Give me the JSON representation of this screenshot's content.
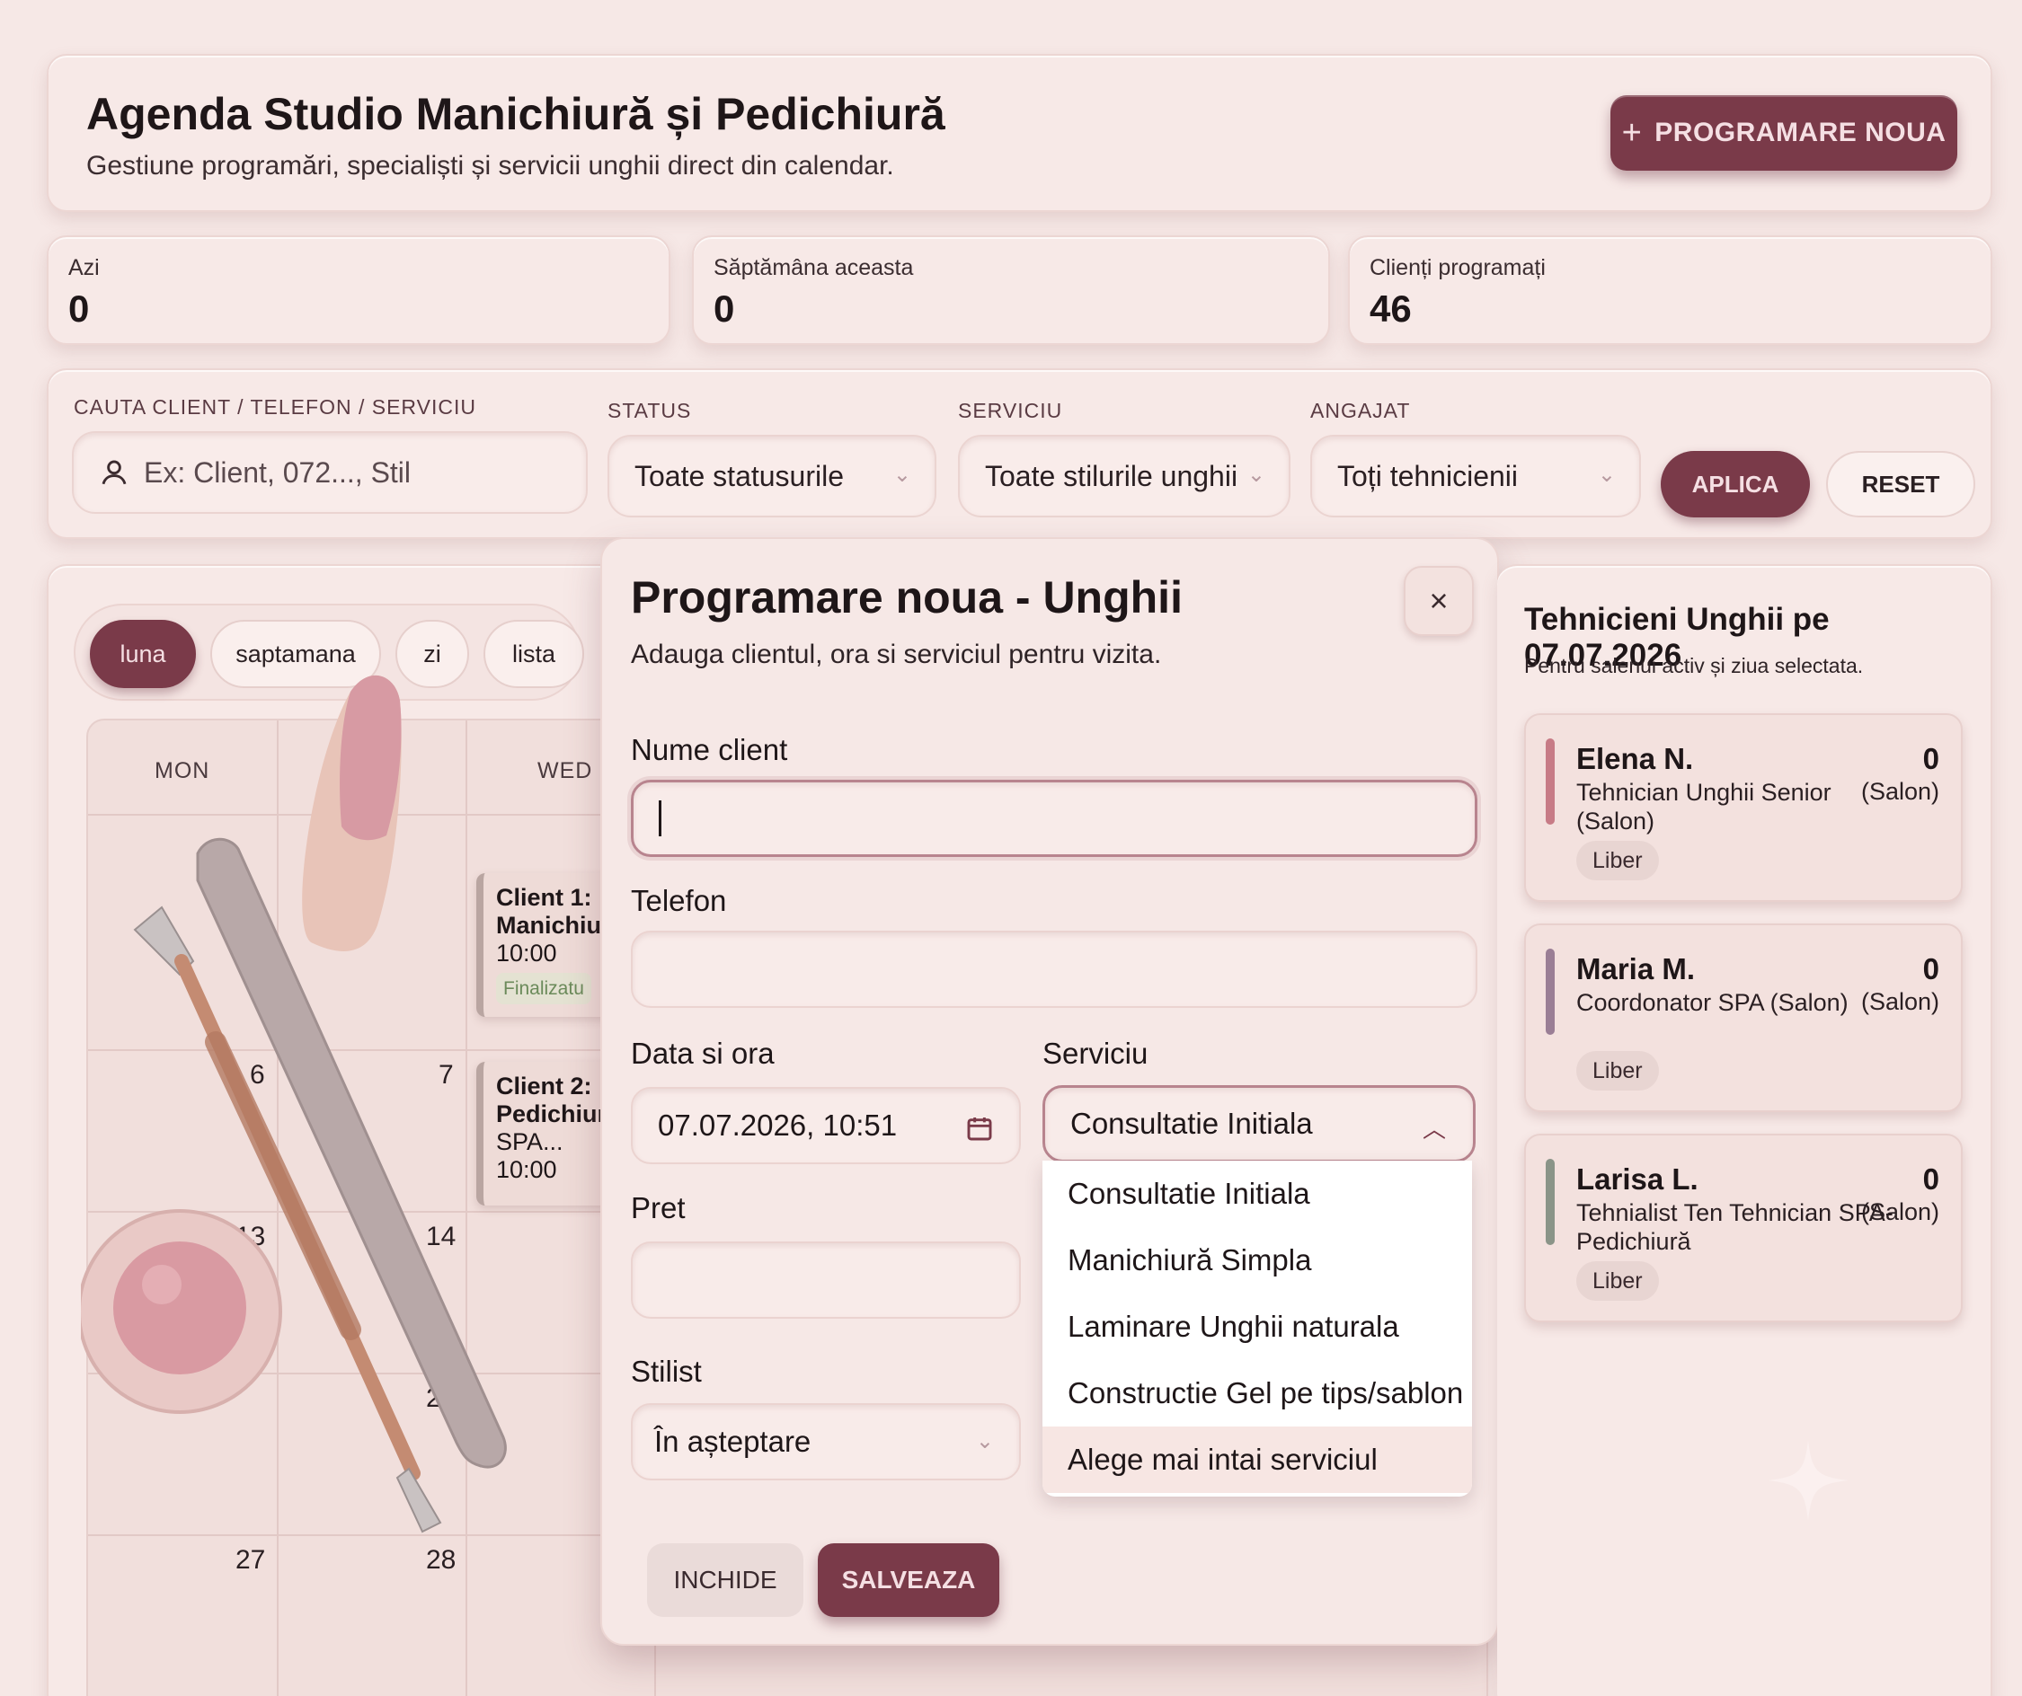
{
  "header": {
    "title": "Agenda Studio Manichiură și Pedichiură",
    "subtitle": "Gestiune programări, specialiști și servicii unghii direct din calendar.",
    "new_button": "PROGRAMARE NOUA",
    "new_button_icon": "plus-icon"
  },
  "stats": {
    "today": {
      "label": "Azi",
      "value": "0"
    },
    "week": {
      "label": "Săptămâna aceasta",
      "value": "0"
    },
    "clients": {
      "label": "Clienți programați",
      "value": "46"
    }
  },
  "filters": {
    "search_label": "CAUTA CLIENT / TELEFON / SERVICIU",
    "search_placeholder": "Ex: Client, 072..., Stil",
    "search_icon": "user-icon",
    "status_label": "STATUS",
    "status_value": "Toate statusurile",
    "service_label": "SERVICIU",
    "service_value": "Toate stilurile unghii",
    "employee_label": "ANGAJAT",
    "employee_value": "Toți tehnicienii",
    "apply": "APLICA",
    "reset": "RESET"
  },
  "calendar": {
    "views": [
      "luna",
      "saptamana",
      "zi",
      "lista"
    ],
    "active_view": "luna",
    "day_headers": {
      "mon": "MON",
      "wed": "WED"
    },
    "day_numbers": {
      "d6": "6",
      "d7": "7",
      "d13": "13",
      "d14": "14",
      "d2x": "2",
      "d27": "27",
      "d28": "28"
    },
    "events": [
      {
        "title": "Client 1:",
        "service": "Manichiur",
        "time": "10:00",
        "status": "Finalizatu"
      },
      {
        "title": "Client 2:",
        "service": "Pedichiur",
        "extra": "SPA...",
        "time": "10:00"
      }
    ]
  },
  "modal": {
    "title": "Programare noua - Unghii",
    "subtitle": "Adauga clientul, ora si serviciul pentru vizita.",
    "close_icon": "close-icon",
    "name_label": "Nume client",
    "name_value": "",
    "phone_label": "Telefon",
    "phone_value": "",
    "datetime_label": "Data si ora",
    "datetime_value": "07.07.2026, 10:51",
    "calendar_icon": "calendar-icon",
    "service_label": "Serviciu",
    "service_value": "Consultatie Initiala",
    "service_options": [
      "Consultatie Initiala",
      "Manichiură Simpla",
      "Laminare Unghii naturala",
      "Constructie Gel pe tips/sablon",
      "Alege mai intai serviciul"
    ],
    "price_label": "Pret",
    "price_value": "",
    "stylist_label": "Stilist",
    "stylist_value": "În așteptare",
    "cancel": "INCHIDE",
    "save": "SALVEAZA"
  },
  "technicians": {
    "title": "Tehnicieni Unghii pe 07.07.2026",
    "subtitle": "Pentru salenui activ și ziua selectata.",
    "items": [
      {
        "name": "Elena N.",
        "role": "Tehnician Unghii Senior (Salon)",
        "count": "0",
        "location": "(Salon)",
        "status": "Liber",
        "color": "#c77b86"
      },
      {
        "name": "Maria M.",
        "role": "Coordonator SPA (Salon)",
        "count": "0",
        "location": "(Salon)",
        "status": "Liber",
        "color": "#9a7e95"
      },
      {
        "name": "Larisa L.",
        "role": "Tehnialist Ten Tehnician SPA-Pedichiură",
        "count": "0",
        "location": "(Salon)",
        "status": "Liber",
        "color": "#8a9488"
      }
    ]
  },
  "colors": {
    "accent": "#7a3a49",
    "background": "#f6e8e6"
  }
}
